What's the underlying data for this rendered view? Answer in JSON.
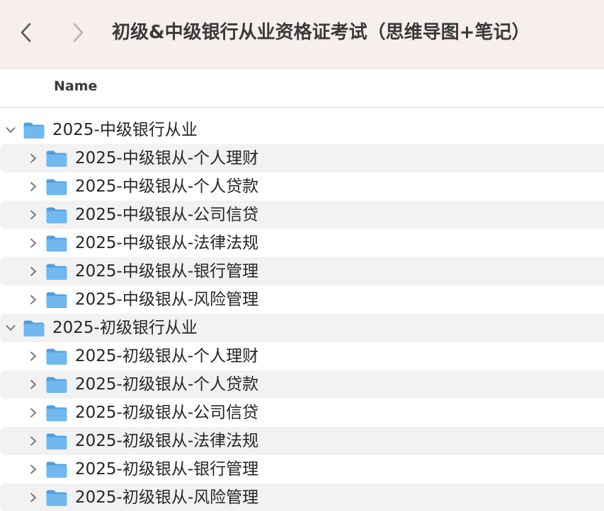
{
  "window": {
    "title": "初级&中级银行从业资格证考试（思维导图+笔记）"
  },
  "icons": {
    "back": "chevron-left-icon",
    "forward": "chevron-right-icon",
    "expanded": "chevron-down-icon",
    "collapsed": "chevron-right-icon",
    "folder": "folder-icon"
  },
  "colors": {
    "toolbar_bg": "#f7efec",
    "folder_blue": "#5aa9e6",
    "row_alt": "#f3f2f2"
  },
  "list_header": {
    "name": "Name"
  },
  "tree": [
    {
      "label": "2025-中级银行从业",
      "expanded": true,
      "children": [
        {
          "label": "2025-中级银从-个人理财"
        },
        {
          "label": "2025-中级银从-个人贷款"
        },
        {
          "label": "2025-中级银从-公司信贷"
        },
        {
          "label": "2025-中级银从-法律法规"
        },
        {
          "label": "2025-中级银从-银行管理"
        },
        {
          "label": "2025-中级银从-风险管理"
        }
      ]
    },
    {
      "label": "2025-初级银行从业",
      "expanded": true,
      "children": [
        {
          "label": "2025-初级银从-个人理财"
        },
        {
          "label": "2025-初级银从-个人贷款"
        },
        {
          "label": "2025-初级银从-公司信贷"
        },
        {
          "label": "2025-初级银从-法律法规"
        },
        {
          "label": "2025-初级银从-银行管理"
        },
        {
          "label": "2025-初级银从-风险管理"
        }
      ]
    }
  ]
}
